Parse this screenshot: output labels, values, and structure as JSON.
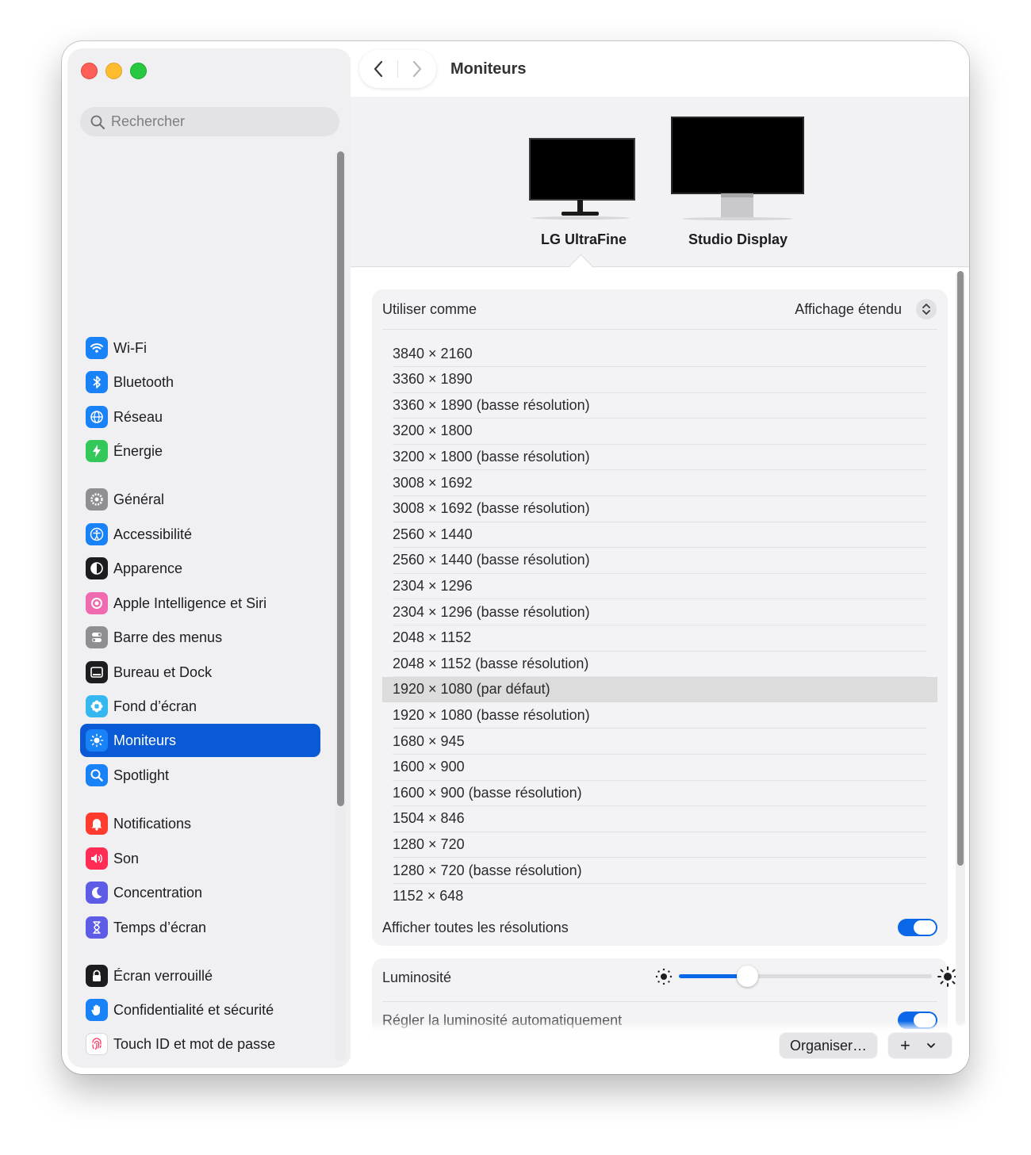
{
  "window": {
    "title": "Moniteurs"
  },
  "search": {
    "placeholder": "Rechercher"
  },
  "sidebar": {
    "items": [
      {
        "label": "Wi-Fi",
        "icon": "wifi-icon",
        "color": "#1a82f7"
      },
      {
        "label": "Bluetooth",
        "icon": "bluetooth-icon",
        "color": "#1a82f7"
      },
      {
        "label": "Réseau",
        "icon": "globe-icon",
        "color": "#1a82f7"
      },
      {
        "label": "Énergie",
        "icon": "bolt-icon",
        "color": "#34c759"
      },
      {
        "label": "Général",
        "icon": "gear-icon",
        "color": "#8e8e93"
      },
      {
        "label": "Accessibilité",
        "icon": "accessibility-icon",
        "color": "#1a82f7"
      },
      {
        "label": "Apparence",
        "icon": "appearance-icon",
        "color": "#1d1d1f"
      },
      {
        "label": "Apple Intelligence et Siri",
        "icon": "siri-icon",
        "color": "#f06ab0"
      },
      {
        "label": "Barre des menus",
        "icon": "menubar-icon",
        "color": "#8e8e93"
      },
      {
        "label": "Bureau et Dock",
        "icon": "dock-icon",
        "color": "#1d1d1f"
      },
      {
        "label": "Fond d’écran",
        "icon": "wallpaper-icon",
        "color": "#35b8f0"
      },
      {
        "label": "Moniteurs",
        "icon": "sun-icon",
        "color": "#1a82f7",
        "selected": true
      },
      {
        "label": "Spotlight",
        "icon": "spotlight-icon",
        "color": "#1a82f7"
      },
      {
        "label": "Notifications",
        "icon": "bell-icon",
        "color": "#ff3b30"
      },
      {
        "label": "Son",
        "icon": "speaker-icon",
        "color": "#ff2d55"
      },
      {
        "label": "Concentration",
        "icon": "moon-icon",
        "color": "#5e5ce6"
      },
      {
        "label": "Temps d’écran",
        "icon": "hourglass-icon",
        "color": "#5e5ce6"
      },
      {
        "label": "Écran verrouillé",
        "icon": "lock-icon",
        "color": "#1d1d1f"
      },
      {
        "label": "Confidentialité et sécurité",
        "icon": "hand-icon",
        "color": "#1a82f7"
      },
      {
        "label": "Touch ID et mot de passe",
        "icon": "fingerprint-icon",
        "color": "#ffffff"
      }
    ]
  },
  "monitors": [
    {
      "label": "LG UltraFine",
      "selected": true
    },
    {
      "label": "Studio Display",
      "selected": false
    }
  ],
  "settings": {
    "use_as_label": "Utiliser comme",
    "use_as_value": "Affichage étendu",
    "resolutions": [
      "3840 × 2160",
      "3360 × 1890",
      "3360 × 1890 (basse résolution)",
      "3200 × 1800",
      "3200 × 1800 (basse résolution)",
      "3008 × 1692",
      "3008 × 1692 (basse résolution)",
      "2560 × 1440",
      "2560 × 1440 (basse résolution)",
      "2304 × 1296",
      "2304 × 1296 (basse résolution)",
      "2048 × 1152",
      "2048 × 1152 (basse résolution)",
      "1920 × 1080 (par défaut)",
      "1920 × 1080 (basse résolution)",
      "1680 × 945",
      "1600 × 900",
      "1600 × 900 (basse résolution)",
      "1504 × 846",
      "1280 × 720",
      "1280 × 720 (basse résolution)",
      "1152 × 648"
    ],
    "selected_resolution": "1920 × 1080 (par défaut)",
    "show_all_label": "Afficher toutes les résolutions",
    "show_all_on": true,
    "brightness_label": "Luminosité",
    "brightness_level": 0.27,
    "auto_brightness_label": "Régler la luminosité automatiquement",
    "auto_brightness_on": true
  },
  "footer": {
    "arrange_label": "Organiser…",
    "add_label": "+"
  },
  "colors": {
    "accent": "#0a68e8",
    "sidebar_selected": "#0a5ad5"
  }
}
